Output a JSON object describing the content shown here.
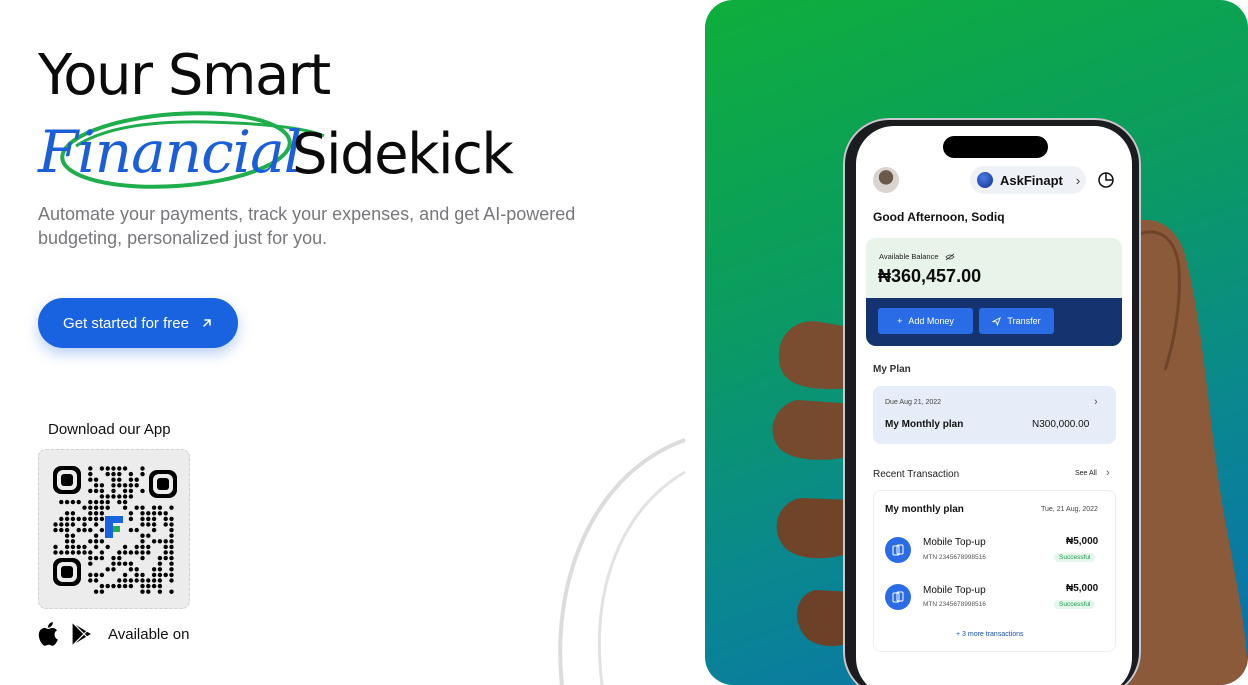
{
  "hero": {
    "title_line1": "Your Smart",
    "title_script": "Financial",
    "title_word": "Sidekick",
    "subtitle": "Automate your payments, track your expenses, and get AI-powered budgeting, personalized just for you.",
    "cta_label": "Get started for free",
    "download_label": "Download our App",
    "available_label": "Available on"
  },
  "colors": {
    "brand_blue": "#1a63e0",
    "script_blue": "#1a5fd9",
    "ellipse_green": "#1fae4b",
    "panel_green": "#0fae3c",
    "panel_blue": "#0a6fb0",
    "balance_footer": "#15336e"
  },
  "icons": {
    "cta": "arrow-up-right-icon",
    "apple": "apple-icon",
    "play": "google-play-icon"
  },
  "app": {
    "assistant_label": "AskFinapt",
    "greeting": "Good Afternoon, Sodiq",
    "balance_label": "Available Balance",
    "balance": "₦360,457.00",
    "add_money_label": "Add Money",
    "transfer_label": "Transfer",
    "my_plan_heading": "My Plan",
    "plan": {
      "due": "Due Aug 21, 2022",
      "name": "My Monthly plan",
      "amount": "N300,000.00"
    },
    "recent_heading": "Recent Transaction",
    "see_all": "See All",
    "tx_card_title": "My monthly plan",
    "tx_card_date": "Tue, 21 Aug, 2022",
    "transactions": [
      {
        "title": "Mobile Top-up",
        "sub": "MTN 2345678998516",
        "amount": "₦5,000",
        "status": "Successful"
      },
      {
        "title": "Mobile Top-up",
        "sub": "MTN 2345678998516",
        "amount": "₦5,000",
        "status": "Successful"
      }
    ],
    "more": "+ 3 more transactions"
  }
}
